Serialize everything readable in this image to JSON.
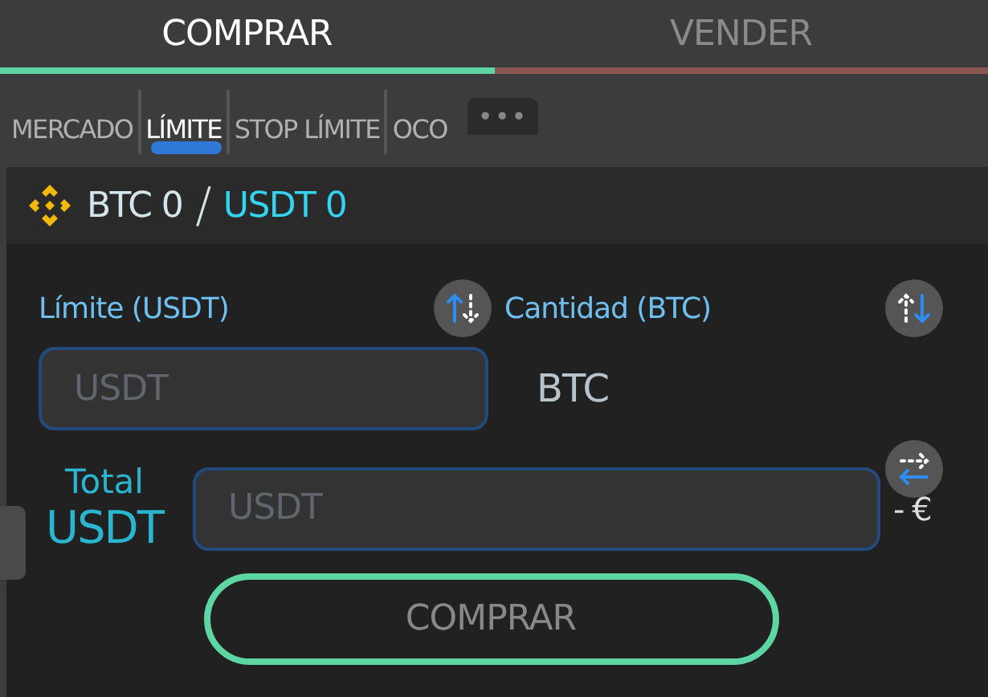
{
  "side_tabs": [
    {
      "label": "COMPRAR",
      "selected": true,
      "color": "#5ed6a4"
    },
    {
      "label": "VENDER",
      "selected": false,
      "color": "#8a5752"
    }
  ],
  "order_types": [
    {
      "label": "MERCADO",
      "selected": false
    },
    {
      "label": "LÍMITE",
      "selected": true
    },
    {
      "label": "STOP LÍMITE",
      "selected": false
    },
    {
      "label": "OCO",
      "selected": false
    }
  ],
  "more_button": "•••",
  "balance": {
    "base": "BTC 0",
    "separator": "/",
    "quote": "USDT 0"
  },
  "limit": {
    "label": "Límite (USDT)",
    "placeholder": "USDT"
  },
  "amount": {
    "label": "Cantidad (BTC)",
    "unit": "BTC"
  },
  "total": {
    "label": "Total",
    "unit": "USDT",
    "placeholder": "USDT",
    "fiat": "- €"
  },
  "submit_button": "COMPRAR"
}
